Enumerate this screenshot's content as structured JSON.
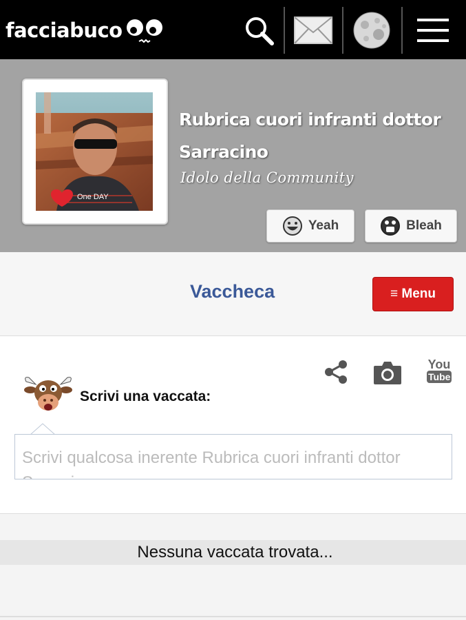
{
  "app": {
    "logo_text": "facciabuco"
  },
  "header": {
    "icons": [
      "search-icon",
      "mail-icon",
      "moon-icon",
      "hamburger-menu-icon"
    ]
  },
  "profile": {
    "name": "Rubrica cuori infranti dottor Sarracino",
    "subtitle": "Idolo della Community",
    "photo_caption": "One DAY",
    "yeah_label": "Yeah",
    "bleah_label": "Bleah"
  },
  "section": {
    "title": "Vaccheca",
    "menu_label": "≡ Menu"
  },
  "post": {
    "label": "Scrivi una vaccata:",
    "placeholder": "Scrivi qualcosa inerente Rubrica cuori infranti dottor Sarracino",
    "icons": [
      "share-icon",
      "camera-icon",
      "youtube-icon"
    ],
    "youtube_top": "You",
    "youtube_bottom": "Tube"
  },
  "feed": {
    "empty_message": "Nessuna vaccata trovata..."
  },
  "colors": {
    "topbar": "#000000",
    "profile_bg": "#a3a3a3",
    "section_title": "#3b5998",
    "menu_button": "#d91f1f"
  }
}
